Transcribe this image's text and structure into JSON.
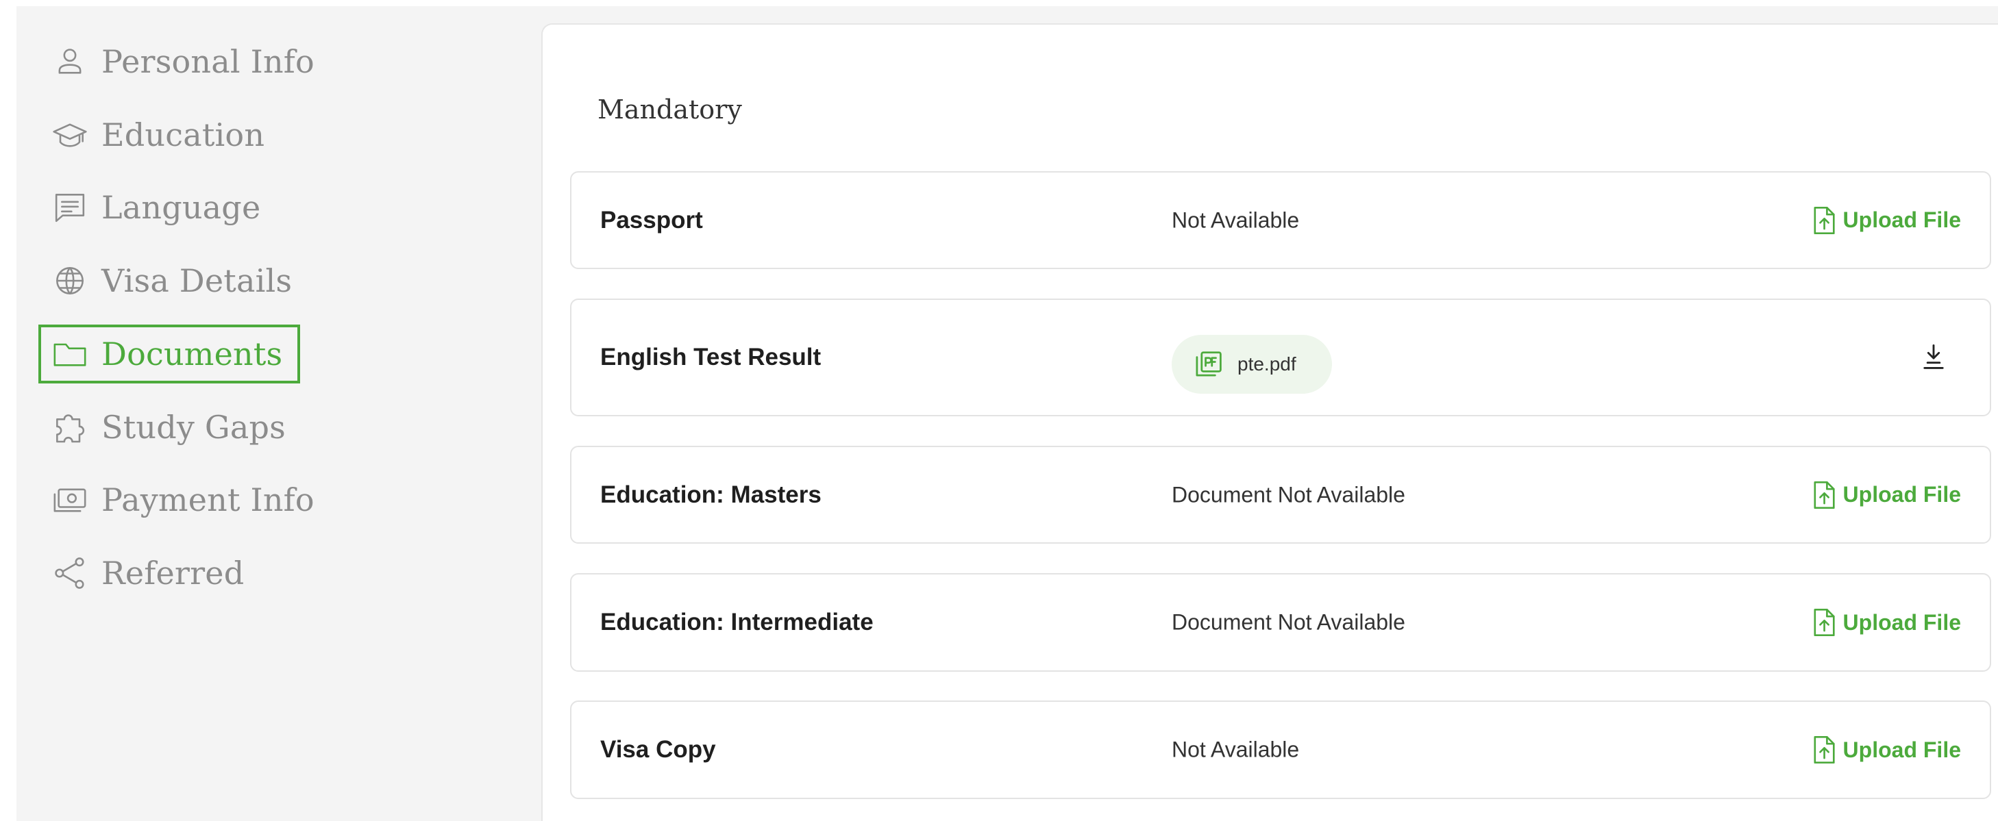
{
  "sidebar": {
    "items": [
      {
        "label": "Personal Info",
        "icon": "person-icon",
        "active": false
      },
      {
        "label": "Education",
        "icon": "graduation-cap-icon",
        "active": false
      },
      {
        "label": "Language",
        "icon": "message-icon",
        "active": false
      },
      {
        "label": "Visa Details",
        "icon": "globe-icon",
        "active": false
      },
      {
        "label": "Documents",
        "icon": "folder-icon",
        "active": true
      },
      {
        "label": "Study Gaps",
        "icon": "puzzle-icon",
        "active": false
      },
      {
        "label": "Payment Info",
        "icon": "cash-icon",
        "active": false
      },
      {
        "label": "Referred",
        "icon": "share-icon",
        "active": false
      }
    ]
  },
  "main": {
    "section_title": "Mandatory",
    "documents": [
      {
        "name": "Passport",
        "status": "Not Available",
        "action": "Upload File"
      },
      {
        "name": "English Test Result",
        "file": "pte.pdf",
        "action_icon": "download-icon"
      },
      {
        "name": "Education: Masters",
        "status": "Document Not Available",
        "action": "Upload File"
      },
      {
        "name": "Education: Intermediate",
        "status": "Document Not Available",
        "action": "Upload File"
      },
      {
        "name": "Visa Copy",
        "status": "Not Available",
        "action": "Upload File"
      }
    ]
  },
  "colors": {
    "accent": "#4caa3c",
    "sidebar_text": "#8c8c8c",
    "sidebar_bg": "#f4f4f4",
    "chip_bg": "#eef6ec"
  }
}
